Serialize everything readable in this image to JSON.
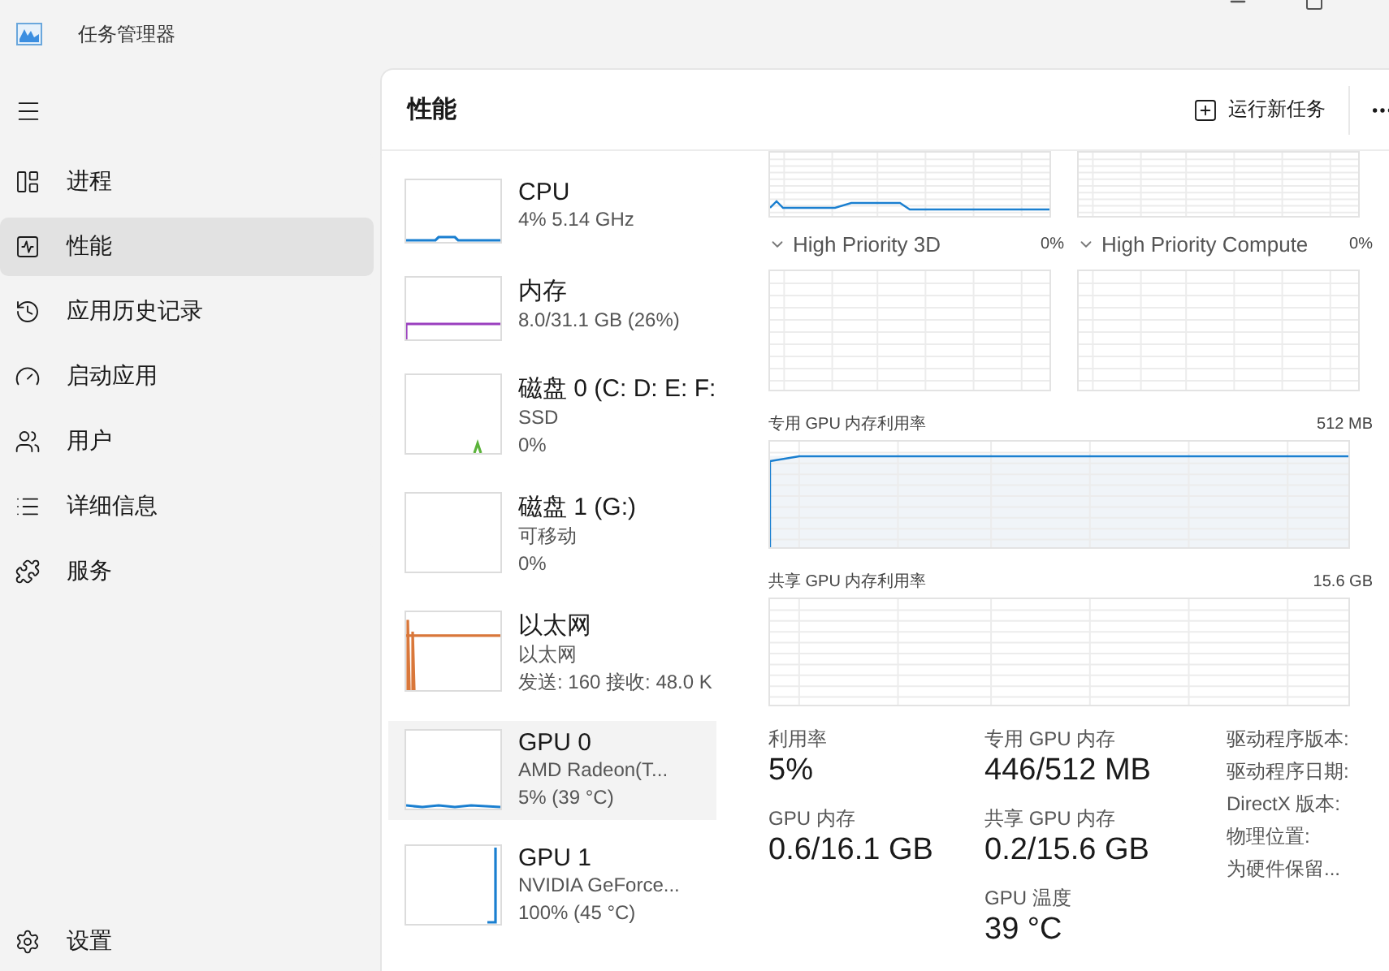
{
  "window": {
    "title": "任务管理器"
  },
  "sidebar": {
    "items": [
      {
        "label": "进程",
        "selected": false
      },
      {
        "label": "性能",
        "selected": true
      },
      {
        "label": "应用历史记录",
        "selected": false
      },
      {
        "label": "启动应用",
        "selected": false
      },
      {
        "label": "用户",
        "selected": false
      },
      {
        "label": "详细信息",
        "selected": false
      },
      {
        "label": "服务",
        "selected": false
      }
    ],
    "footer_item": {
      "label": "设置"
    }
  },
  "header": {
    "title": "性能",
    "run_task": "运行新任务"
  },
  "devices": [
    {
      "name": "CPU",
      "lines": [
        "4% 5.14 GHz"
      ],
      "color": "#1a7fd0",
      "selected": false
    },
    {
      "name": "内存",
      "lines": [
        "8.0/31.1 GB (26%)"
      ],
      "color": "#9a3fbf",
      "selected": false
    },
    {
      "name": "磁盘 0 (C: D: E: F:",
      "lines": [
        "SSD",
        "0%"
      ],
      "color": "#5bb33a",
      "selected": false
    },
    {
      "name": "磁盘 1 (G:)",
      "lines": [
        "可移动",
        "0%"
      ],
      "selected": false
    },
    {
      "name": "以太网",
      "lines": [
        "以太网",
        "发送: 160 接收: 48.0 K"
      ],
      "color": "#d9773a",
      "selected": false
    },
    {
      "name": "GPU 0",
      "lines": [
        "AMD Radeon(T...",
        "5% (39 °C)"
      ],
      "color": "#1a7fd0",
      "selected": true
    },
    {
      "name": "GPU 1",
      "lines": [
        "NVIDIA GeForce...",
        "100% (45 °C)"
      ],
      "color": "#1a7fd0",
      "selected": false
    }
  ],
  "detail": {
    "engines": [
      {
        "name": "High Priority 3D",
        "value": "0%"
      },
      {
        "name": "High Priority Compute",
        "value": "0%"
      }
    ],
    "dedicated_memory": {
      "label": "专用 GPU 内存利用率",
      "max": "512 MB"
    },
    "shared_memory": {
      "label": "共享 GPU 内存利用率",
      "max": "15.6 GB"
    },
    "stats": [
      [
        {
          "label": "利用率",
          "value": "5%"
        },
        {
          "label": "GPU 内存",
          "value": "0.6/16.1 GB"
        }
      ],
      [
        {
          "label": "专用 GPU 内存",
          "value": "446/512 MB"
        },
        {
          "label": "共享 GPU 内存",
          "value": "0.2/15.6 GB"
        },
        {
          "label": "GPU 温度",
          "value": "39 °C"
        }
      ]
    ],
    "info_labels": [
      "驱动程序版本:",
      "驱动程序日期:",
      "DirectX 版本:",
      "物理位置:",
      "为硬件保留..."
    ]
  }
}
